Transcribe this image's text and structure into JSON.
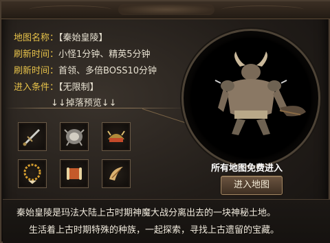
{
  "map_info": {
    "name_label": "地图名称：",
    "name_value": "【秦始皇陵】",
    "refresh1_label": "刷新时间：",
    "refresh1_value": "小怪1分钟、精英5分钟",
    "refresh2_label": "刷新时间：",
    "refresh2_value": "首领、多倍BOSS10分钟",
    "condition_label": "进入条件：",
    "condition_value": "【无限制】"
  },
  "drops": {
    "title": "↓↓掉落预览↓↓",
    "items": [
      {
        "icon": "sword-icon"
      },
      {
        "icon": "armor-icon"
      },
      {
        "icon": "helmet-icon"
      },
      {
        "icon": "necklace-icon"
      },
      {
        "icon": "scroll-icon"
      },
      {
        "icon": "horn-icon"
      }
    ]
  },
  "portrait": {
    "icon": "minotaur-boss-icon"
  },
  "free_text": "所有地图免费进入",
  "enter_button": "进入地图",
  "description": {
    "line1": "秦始皇陵是玛法大陆上古时期神魔大战分离出去的一块神秘土地。",
    "line2": "生活着上古时期特殊的种族，一起探索，寻找上古遗留的宝藏。"
  },
  "colors": {
    "label": "#e8c34a",
    "text": "#e8e2d2",
    "border": "#6a5a46"
  }
}
